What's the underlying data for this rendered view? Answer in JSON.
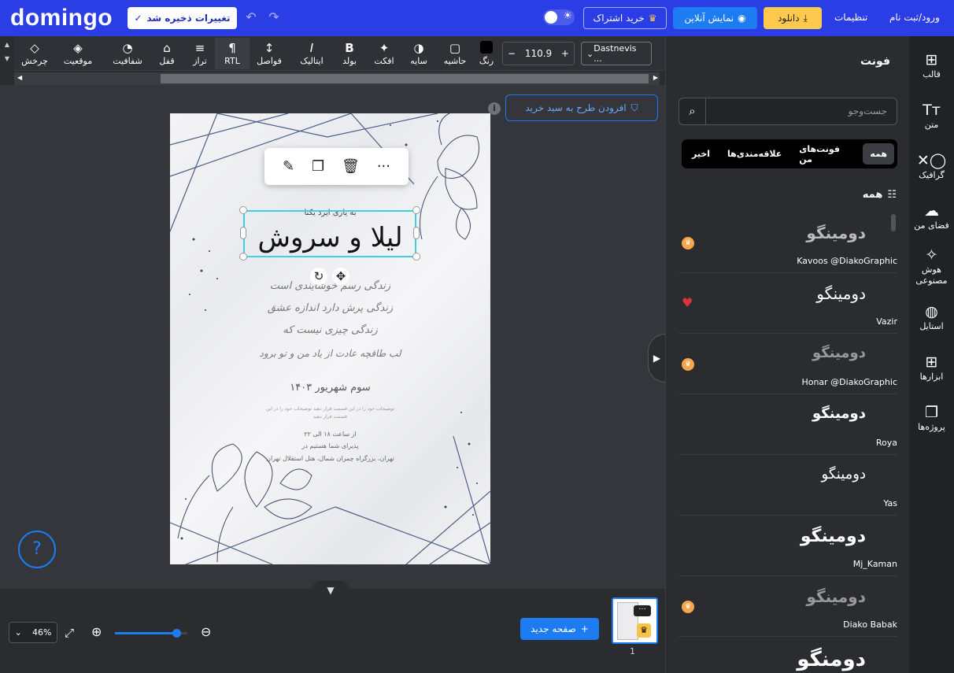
{
  "header": {
    "logo": "domingo",
    "save_status": "تغییرات ذخیره شد",
    "subscribe": "خرید اشتراک",
    "online_preview": "نمایش آنلاین",
    "download": "دانلود",
    "settings": "تنظیمات",
    "login": "ورود/ثبت نام"
  },
  "toolbar": {
    "font_name": "Dastnevis ...",
    "font_size": "110.9",
    "items": [
      {
        "label": "رنگ",
        "icon": "color-swatch-icon"
      },
      {
        "label": "حاشیه",
        "icon": "stroke-icon"
      },
      {
        "label": "سایه",
        "icon": "shadow-icon"
      },
      {
        "label": "افکت",
        "icon": "magic-wand-icon"
      },
      {
        "label": "بولد",
        "icon": "bold-icon"
      },
      {
        "label": "ایتالیک",
        "icon": "italic-icon"
      },
      {
        "label": "فواصل",
        "icon": "spacing-icon"
      },
      {
        "label": "RTL",
        "icon": "rtl-icon"
      },
      {
        "label": "تراز",
        "icon": "align-icon"
      },
      {
        "label": "قفل",
        "icon": "lock-icon"
      },
      {
        "label": "شفافیت",
        "icon": "opacity-icon"
      },
      {
        "label": "موقعیت",
        "icon": "layers-icon"
      },
      {
        "label": "چرخش",
        "icon": "rotate-icon"
      }
    ]
  },
  "canvas": {
    "add_to_cart": "افزودن طرح به سبد خرید",
    "invite": {
      "small_heading": "به یاری ایزد یکتا",
      "names": "لیلا و سروش",
      "poem": [
        "زندگی رسم خوشایندی است",
        "زندگی پرش دارد اندازه عشق",
        "زندگی چیزی نیست که",
        "لب طاقچه عادت از یاد من و تو برود"
      ],
      "date": "سوم شهریور ۱۴۰۳",
      "desc": [
        "توضیحات خود را در این قسمت قرار دهید توضیحات خود را در این",
        "قسمت قرار دهید"
      ],
      "time": "از ساعت ۱۸ الی ۲۲",
      "waiting": "پذیرای شما هستیم در",
      "venue": "تهران، بزرگراه چمران شمال، هتل استقلال تهران"
    }
  },
  "bottom": {
    "zoom": "46%",
    "zoom_level": 0.85,
    "new_page": "صفحه جدید",
    "page_number": "1"
  },
  "panel": {
    "title": "فونت",
    "search_placeholder": "جست‌وجو",
    "tabs": [
      "همه",
      "فونت‌های من",
      "علاقه‌مندی‌ها",
      "اخیر"
    ],
    "section": "همه",
    "fonts": [
      {
        "sample": "دومینگو",
        "name": "Kavoos @DiakoGraphic",
        "badge": "crown",
        "style": "letter-spacing:2px;color:#bbb;font-weight:bold"
      },
      {
        "sample": "دومینگو",
        "name": "Vazir",
        "badge": "heart",
        "style": "color:#fff"
      },
      {
        "sample": "دومینگو",
        "name": "Honar @DiakoGraphic",
        "badge": "crown",
        "style": "color:#999;font-weight:bold;font-size:18px"
      },
      {
        "sample": "دومینگو",
        "name": "Roya",
        "badge": "",
        "style": "color:#fff;font-weight:bold;font-size:18px"
      },
      {
        "sample": "دومینگو",
        "name": "Yas",
        "badge": "",
        "style": "color:#fff;font-size:18px"
      },
      {
        "sample": "دومینگو",
        "name": "Mj_Kaman",
        "badge": "",
        "style": "color:#fff;font-weight:bold;font-size:22px"
      },
      {
        "sample": "دومینگو",
        "name": "Diako Babak",
        "badge": "crown",
        "style": "color:#999;font-weight:bold;font-size:20px"
      },
      {
        "sample": "دومنگو",
        "name": "",
        "badge": "",
        "style": "color:#fff;font-weight:bold;font-size:26px"
      }
    ]
  },
  "rail": [
    {
      "label": "قالب",
      "icon": "layout-icon"
    },
    {
      "label": "متن",
      "icon": "text-icon"
    },
    {
      "label": "گرافیک",
      "icon": "shapes-icon"
    },
    {
      "label": "فضای من",
      "icon": "upload-cloud-icon"
    },
    {
      "label": "هوش مصنوعی",
      "icon": "ai-wand-icon"
    },
    {
      "label": "استایل",
      "icon": "palette-icon"
    },
    {
      "label": "ابزارها",
      "icon": "tools-icon"
    },
    {
      "label": "پروژه‌ها",
      "icon": "projects-icon"
    }
  ]
}
